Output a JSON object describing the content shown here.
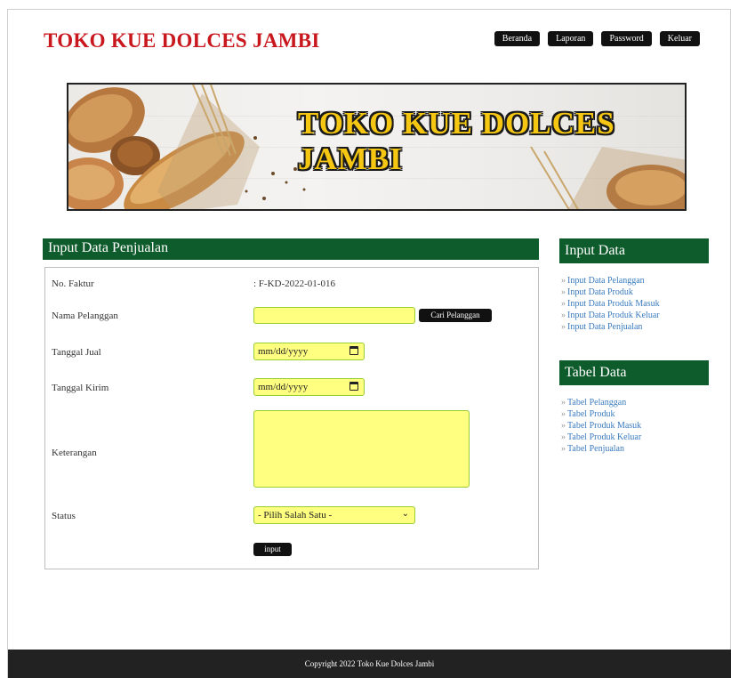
{
  "header": {
    "title": "TOKO KUE DOLCES JAMBI",
    "nav": [
      "Beranda",
      "Laporan",
      "Password",
      "Keluar"
    ]
  },
  "banner": {
    "text": "TOKO KUE DOLCES JAMBI"
  },
  "form": {
    "heading": "Input Data Penjualan",
    "faktur_label": "No. Faktur",
    "faktur_value": ": F-KD-2022-01-016",
    "pelanggan_label": "Nama Pelanggan",
    "pelanggan_value": "",
    "cari_button": "Cari Pelanggan",
    "tanggal_jual_label": "Tanggal Jual",
    "tanggal_jual_value": "mm/dd/yyyy",
    "tanggal_kirim_label": "Tanggal Kirim",
    "tanggal_kirim_value": "mm/dd/yyyy",
    "keterangan_label": "Keterangan",
    "keterangan_value": "",
    "status_label": "Status",
    "status_value": "- Pilih Salah Satu -",
    "submit_label": "input"
  },
  "sidebar": {
    "input_heading": "Input Data",
    "input_items": [
      "Input Data Pelanggan",
      "Input Data Produk",
      "Input Data Produk Masuk",
      "Input Data Produk Keluar",
      "Input Data Penjualan"
    ],
    "tabel_heading": "Tabel Data",
    "tabel_items": [
      "Tabel Pelanggan",
      "Tabel Produk",
      "Tabel Produk Masuk",
      "Tabel Produk Keluar",
      "Tabel Penjualan"
    ]
  },
  "footer": {
    "text": "Copyright 2022 Toko Kue Dolces Jambi"
  },
  "colors": {
    "brand_red": "#c8181e",
    "section_green": "#0e5b2c",
    "input_yellow": "#ffff80",
    "link_blue": "#3a7bbf",
    "footer_bg": "#222222"
  }
}
